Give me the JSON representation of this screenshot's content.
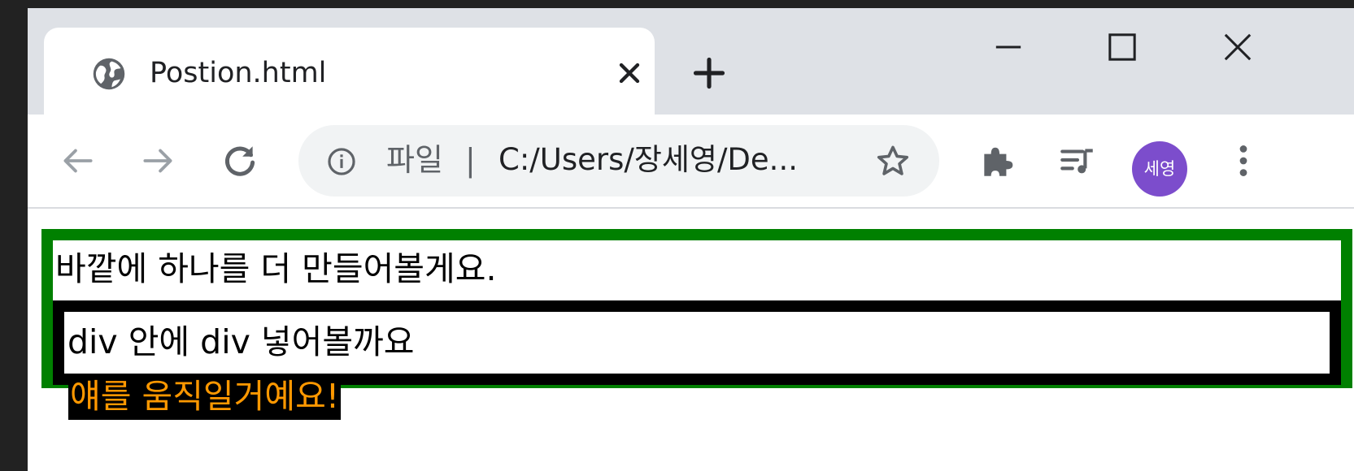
{
  "tab": {
    "title": "Postion.html",
    "favicon": "globe-icon"
  },
  "window_controls": [
    "minimize-icon",
    "maximize-icon",
    "close-icon"
  ],
  "toolbar": {
    "omnibox": {
      "scheme_label": "파일",
      "separator": "|",
      "url": "C:/Users/장세영/De..."
    },
    "profile_initials": "세영"
  },
  "colors": {
    "outer_border": "#008000",
    "inner_border": "#000000",
    "moving_text": "#ff9800",
    "moving_bg": "#000000",
    "avatar_bg": "#7c4dcc"
  },
  "page": {
    "outer_text": "바깥에 하나를 더 만들어볼게요.",
    "inner_text": "div 안에 div 넣어볼까요",
    "moving_text": "얘를 움직일거예요!"
  }
}
